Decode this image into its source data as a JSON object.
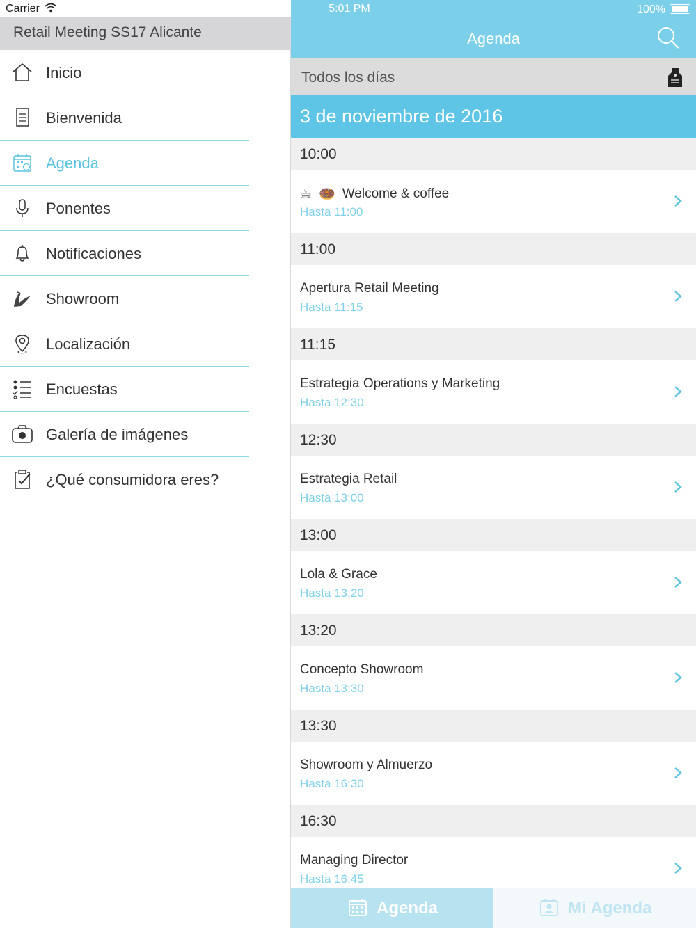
{
  "status_bar": {
    "carrier": "Carrier",
    "time": "5:01 PM",
    "battery": "100%"
  },
  "sidebar": {
    "title": "Retail Meeting SS17 Alicante",
    "items": [
      {
        "label": "Inicio",
        "icon": "home-icon"
      },
      {
        "label": "Bienvenida",
        "icon": "document-icon"
      },
      {
        "label": "Agenda",
        "icon": "calendar-icon",
        "active": true
      },
      {
        "label": "Ponentes",
        "icon": "microphone-icon"
      },
      {
        "label": "Notificaciones",
        "icon": "bell-icon"
      },
      {
        "label": "Showroom",
        "icon": "swan-icon"
      },
      {
        "label": "Localización",
        "icon": "location-pin-icon"
      },
      {
        "label": "Encuestas",
        "icon": "checklist-icon"
      },
      {
        "label": "Galería de imágenes",
        "icon": "camera-icon"
      },
      {
        "label": "¿Qué consumidora eres?",
        "icon": "clipboard-check-icon"
      }
    ]
  },
  "header": {
    "title": "Agenda"
  },
  "filter": {
    "label": "Todos los días"
  },
  "date": "3 de noviembre de 2016",
  "schedule": [
    {
      "time": "10:00",
      "title": "Welcome & coffee",
      "until": "Hasta 11:00",
      "emoji": [
        "☕",
        "🍩"
      ]
    },
    {
      "time": "11:00",
      "title": "Apertura Retail Meeting",
      "until": "Hasta 11:15"
    },
    {
      "time": "11:15",
      "title": "Estrategia Operations y Marketing",
      "until": "Hasta 12:30"
    },
    {
      "time": "12:30",
      "title": "Estrategia Retail",
      "until": "Hasta 13:00"
    },
    {
      "time": "13:00",
      "title": "Lola & Grace",
      "until": "Hasta 13:20"
    },
    {
      "time": "13:20",
      "title": "Concepto Showroom",
      "until": "Hasta 13:30"
    },
    {
      "time": "13:30",
      "title": "Showroom y Almuerzo",
      "until": "Hasta 16:30"
    },
    {
      "time": "16:30",
      "title": "Managing Director",
      "until": "Hasta 16:45"
    }
  ],
  "tabs": {
    "agenda": "Agenda",
    "mi_agenda": "Mi Agenda"
  },
  "colors": {
    "accent": "#5fc5e6",
    "topbar": "#7ccfe8",
    "divider": "#8fd6e8"
  }
}
